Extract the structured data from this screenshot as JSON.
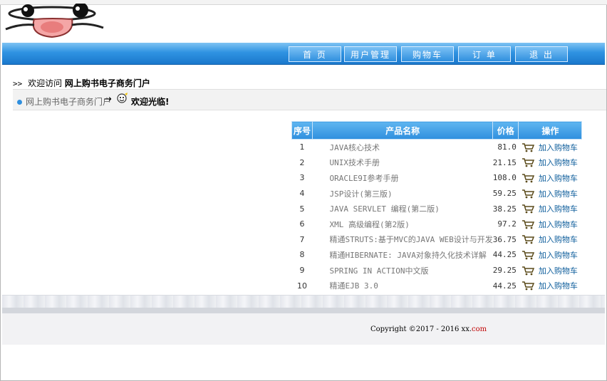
{
  "nav": {
    "items": [
      "首 页",
      "用户管理",
      "购物车",
      "订 单",
      "退 出"
    ]
  },
  "welcome": {
    "prefix": "欢迎访问",
    "site_name": "网上购书电子商务门户"
  },
  "breadcrumb": {
    "link": "网上购书电子商务门户",
    "arrow": "→",
    "greeting": "欢迎光临!"
  },
  "table": {
    "headers": [
      "序号",
      "产品名称",
      "价格",
      "操作"
    ],
    "action_label": "加入购物车",
    "rows": [
      {
        "index": "1",
        "name": "JAVA核心技术",
        "price": "81.0"
      },
      {
        "index": "2",
        "name": "UNIX技术手册",
        "price": "21.15"
      },
      {
        "index": "3",
        "name": "ORACLE9I参考手册",
        "price": "108.0"
      },
      {
        "index": "4",
        "name": "JSP设计(第三版)",
        "price": "59.25"
      },
      {
        "index": "5",
        "name": "JAVA SERVLET 编程(第二版)",
        "price": "38.25"
      },
      {
        "index": "6",
        "name": "XML 高级编程(第2版)",
        "price": "97.2"
      },
      {
        "index": "7",
        "name": "精通STRUTS:基于MVC的JAVA WEB设计与开发",
        "price": "36.75"
      },
      {
        "index": "8",
        "name": "精通HIBERNATE: JAVA对象持久化技术详解",
        "price": "44.25"
      },
      {
        "index": "9",
        "name": "SPRING IN ACTION中文版",
        "price": "29.25"
      },
      {
        "index": "10",
        "name": "精通EJB 3.0",
        "price": "44.25"
      }
    ]
  },
  "footer": {
    "copyright": "Copyright ©2017 - 2016 xx.",
    "domain": "com"
  },
  "colors": {
    "nav_blue": "#2f8fde",
    "link_blue": "#0d5d9b",
    "footer_red": "#c00000"
  },
  "icons": {
    "logo": "cartoon-face-logo",
    "cart": "shopping-cart-icon",
    "greeting": "smiley-face-icon",
    "breadcrumb_bullet": "blue-dot-icon"
  }
}
